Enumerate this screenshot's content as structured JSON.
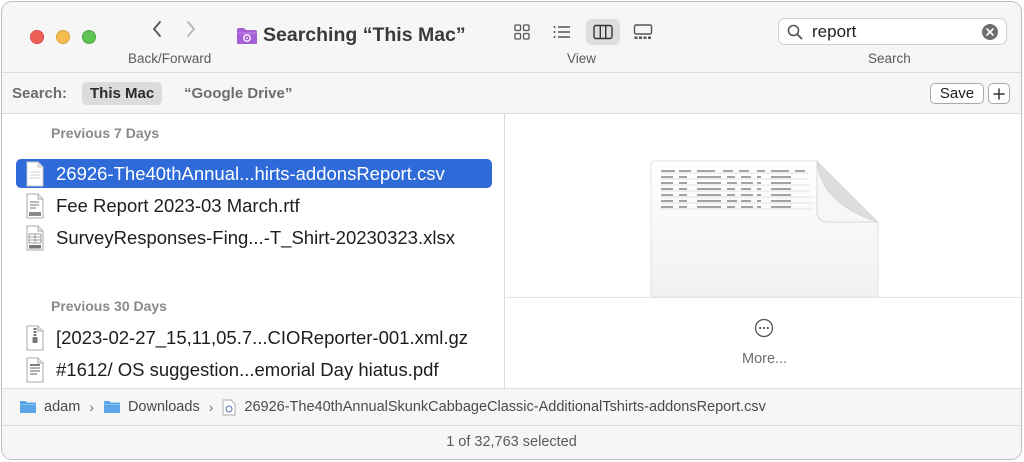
{
  "toolbar": {
    "title": "Searching “This Mac”",
    "nav_label": "Back/Forward",
    "view_label": "View",
    "search_label": "Search",
    "search_value": "report",
    "view_modes": [
      "icons",
      "list",
      "columns",
      "gallery"
    ],
    "active_view": "columns"
  },
  "scope": {
    "label": "Search:",
    "options": [
      "This Mac",
      "“Google Drive”"
    ],
    "selected": "This Mac",
    "save_label": "Save"
  },
  "results": {
    "sections": [
      {
        "header": "Previous 7 Days",
        "files": [
          {
            "name": "26926-The40thAnnual...hirts-addonsReport.csv",
            "icon": "csv-document-icon",
            "selected": true
          },
          {
            "name": "Fee Report 2023-03 March.rtf",
            "icon": "rtf-document-icon",
            "selected": false
          },
          {
            "name": "SurveyResponses-Fing...-T_Shirt-20230323.xlsx",
            "icon": "xlsx-document-icon",
            "selected": false
          }
        ]
      },
      {
        "header": "Previous 30 Days",
        "files": [
          {
            "name": "[2023-02-27_15,11,05.7...CIOReporter-001.xml.gz",
            "icon": "archive-document-icon",
            "selected": false
          },
          {
            "name": "#1612/ OS suggestion...emorial Day hiatus.pdf",
            "icon": "pdf-document-icon",
            "selected": false
          }
        ]
      }
    ]
  },
  "preview": {
    "more_label": "More..."
  },
  "path": {
    "crumbs": [
      "adam",
      "Downloads",
      "26926-The40thAnnualSkunkCabbageClassic-AdditionalTshirts-addonsReport.csv"
    ]
  },
  "status": {
    "text": "1 of 32,763 selected"
  },
  "colors": {
    "selection": "#2e6bd8",
    "folder": "#5aa6e8",
    "smart_folder": "#a55fd4"
  }
}
